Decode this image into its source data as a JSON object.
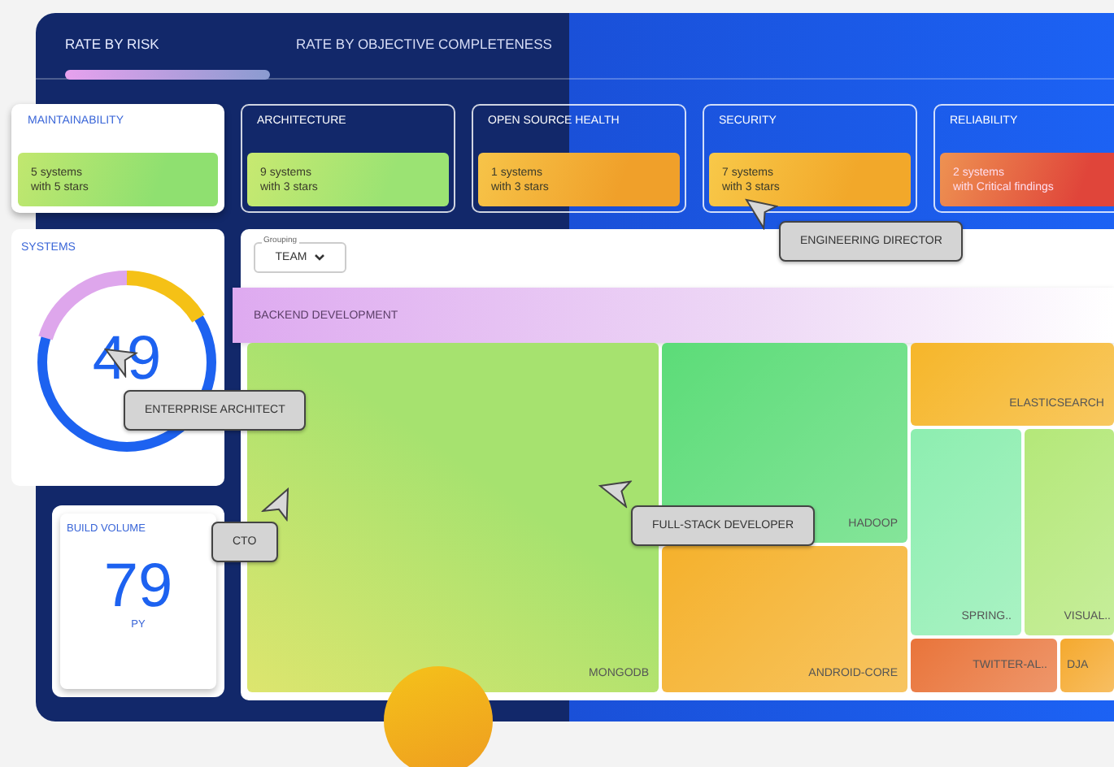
{
  "tabs": [
    {
      "label": "RATE BY RISK",
      "selected": true
    },
    {
      "label": "RATE BY OBJECTIVE COMPLETENESS",
      "selected": false
    }
  ],
  "categories": [
    {
      "title": "MAINTAINABILITY",
      "summary_lines": [
        "5 systems",
        "with 5 stars"
      ],
      "selected": true,
      "color": "#8fe070"
    },
    {
      "title": "ARCHITECTURE",
      "summary_lines": [
        "9 systems",
        "with 3 stars"
      ],
      "selected": false,
      "color": "#9be373"
    },
    {
      "title": "OPEN SOURCE HEALTH",
      "summary_lines": [
        "1 systems",
        "with 3 stars"
      ],
      "selected": false,
      "color": "#f0a02a"
    },
    {
      "title": "SECURITY",
      "summary_lines": [
        "7 systems",
        "with 3 stars"
      ],
      "selected": false,
      "color": "#f2a82a"
    },
    {
      "title": "RELIABILITY",
      "summary_lines": [
        "2 systems",
        "with Critical findings"
      ],
      "selected": false,
      "color": "#e0453a"
    }
  ],
  "systems": {
    "title": "SYSTEMS",
    "value": "49"
  },
  "build_volume": {
    "title": "BUILD VOLUME",
    "value": "79",
    "unit": "PY"
  },
  "grouping": {
    "label": "Grouping",
    "value": "TEAM"
  },
  "group_band": {
    "label": "BACKEND DEVELOPMENT"
  },
  "treemap": [
    {
      "label": "MONGODB",
      "color": "#a6e26f"
    },
    {
      "label": "HADOOP",
      "color": "#5cdc78"
    },
    {
      "label": "ANDROID-CORE",
      "color": "#f5b12c"
    },
    {
      "label": "ELASTICSEARCH",
      "color": "#f6b62a"
    },
    {
      "label": "SPRING..",
      "color": "#8deeb0"
    },
    {
      "label": "VISUAL..",
      "color": "#b4e879"
    },
    {
      "label": "TWITTER-AL..",
      "color": "#e9743a"
    },
    {
      "label": "DJA",
      "color": "#f5a92e"
    }
  ],
  "cursors": [
    {
      "label": "ENGINEERING DIRECTOR"
    },
    {
      "label": "ENTERPRISE ARCHITECT"
    },
    {
      "label": "CTO"
    },
    {
      "label": "FULL-STACK DEVELOPER"
    }
  ]
}
